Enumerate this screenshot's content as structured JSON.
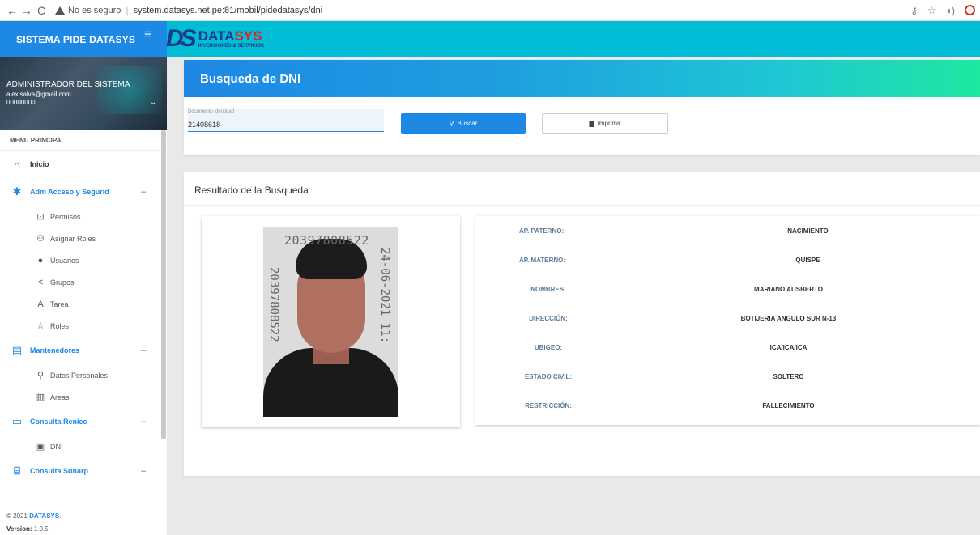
{
  "browser": {
    "insecure_label": "No es seguro",
    "url": "system.datasys.net.pe:81/mobil/pidedatasys/dni"
  },
  "header": {
    "brand": "SISTEMA PIDE DATASYS",
    "logo_ds": "DS",
    "logo_name_a": "DATA",
    "logo_name_b": "SYS",
    "logo_sub": "INVERSIONES & SERVICIOS"
  },
  "user": {
    "name": "ADMINISTRADOR DEL SISTEMA",
    "email": "alexisalva@gmail.com",
    "code": "00000000"
  },
  "menu": {
    "heading": "MENU PRINCIPAL",
    "inicio": "Inicio",
    "groups": {
      "acceso": "Adm Acceso y Segurid",
      "mantenedores": "Mantenedores",
      "reniec": "Consulta Reniec",
      "sunarp": "Consulta Sunarp"
    },
    "acceso_items": [
      "Permisos",
      "Asignar Roles",
      "Usuarios",
      "Grupos",
      "Tarea",
      "Roles"
    ],
    "mantenedores_items": [
      "Datos Personales",
      "Areas"
    ],
    "reniec_items": [
      "DNI"
    ]
  },
  "footer": {
    "copyright_prefix": "© 2021",
    "brand": "DATASYS",
    "period": ".",
    "version_label": "Version:",
    "version": "1.0.5"
  },
  "search": {
    "title": "Busqueda de DNI",
    "doc_label": "Documento Identidad",
    "doc_value": "21408618",
    "buscar_label": "Buscar",
    "imprimir_label": "Imprimir"
  },
  "result": {
    "title": "Resultado de la Busqueda",
    "photo_number": "20397808522",
    "photo_date": "24-06-2021 11:",
    "fields": [
      {
        "label": "AP. PATERNO:",
        "value": "NACIMIENTO"
      },
      {
        "label": "AP. MATERNO:",
        "value": "QUISPE"
      },
      {
        "label": "NOMBRES:",
        "value": "MARIANO AUSBERTO"
      },
      {
        "label": "DIRECCIÓN:",
        "value": "BOTIJERIA ANGULO SUR N-13"
      },
      {
        "label": "UBIGEO:",
        "value": "ICA/ICA/ICA"
      },
      {
        "label": "ESTADO CIVIL:",
        "value": "SOLTERO"
      },
      {
        "label": "RESTRICCIÓN:",
        "value": "FALLECIMIENTO"
      }
    ]
  },
  "colors": {
    "primary": "#1e88e5",
    "accent": "#00bcd4",
    "label": "#5a7a9a"
  }
}
